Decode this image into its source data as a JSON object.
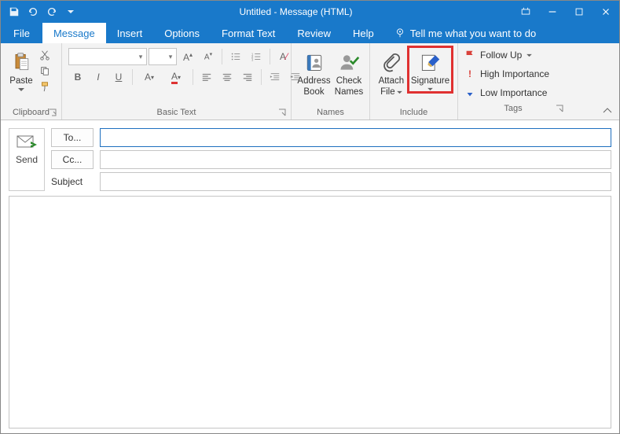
{
  "titlebar": {
    "title": "Untitled -  Message (HTML)"
  },
  "menu": {
    "file": "File",
    "message": "Message",
    "insert": "Insert",
    "options": "Options",
    "format_text": "Format Text",
    "review": "Review",
    "help": "Help",
    "tellme": "Tell me what you want to do"
  },
  "ribbon": {
    "clipboard": {
      "paste": "Paste",
      "label": "Clipboard"
    },
    "basic_text": {
      "label": "Basic Text"
    },
    "names": {
      "address_book_l1": "Address",
      "address_book_l2": "Book",
      "check_names_l1": "Check",
      "check_names_l2": "Names",
      "label": "Names"
    },
    "include": {
      "attach_file_l1": "Attach",
      "attach_file_l2": "File",
      "signature_l1": "Signature",
      "label": "Include"
    },
    "tags": {
      "follow_up": "Follow Up",
      "high": "High Importance",
      "low": "Low Importance",
      "label": "Tags"
    }
  },
  "fields": {
    "send": "Send",
    "to": "To...",
    "cc": "Cc...",
    "subject": "Subject"
  }
}
